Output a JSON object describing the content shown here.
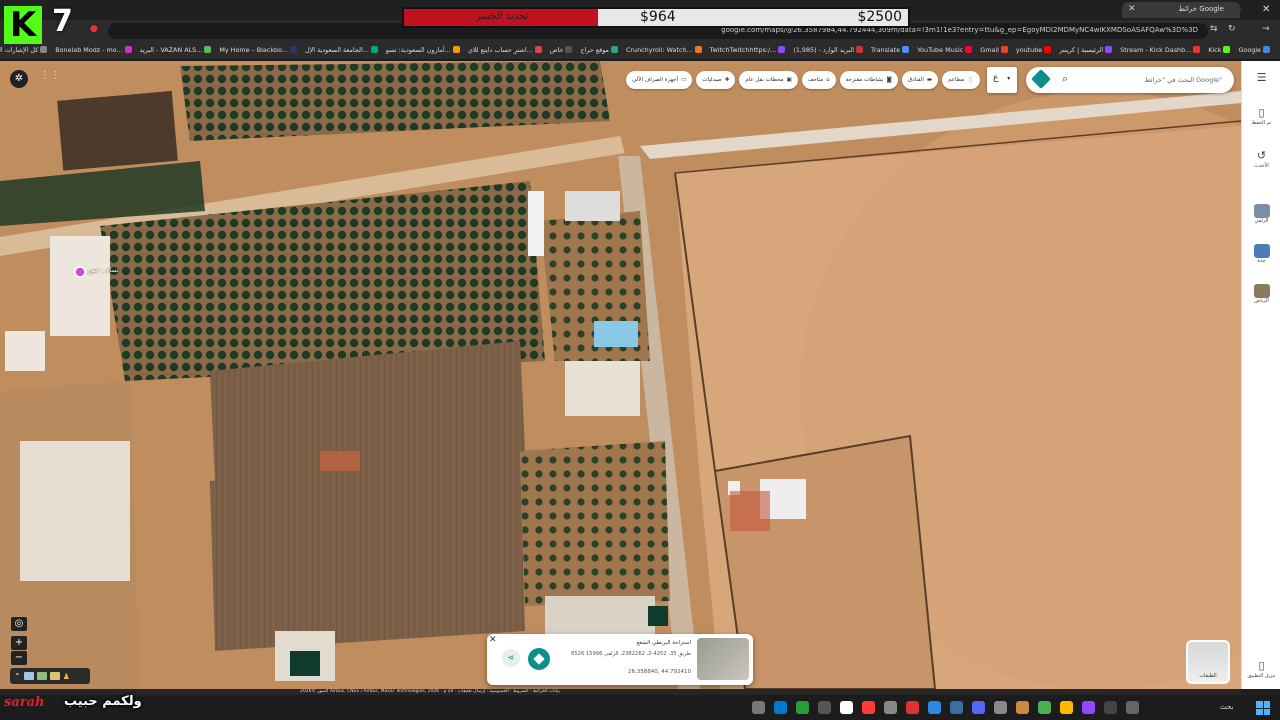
{
  "browser": {
    "tab_title": "خرائط Google",
    "url": "google.com/maps/@26.3587984,44.792444,309m/data=!3m1!1e3?entry=ttu&g_ep=EgoyMDI2MDMyNC4wIKXMDSoASAFQAw%3D%3D",
    "bookmarks": [
      "Google",
      "Kick",
      "Stream - Kick Dashb...",
      "الرئيسية | كرينتر",
      "youtube",
      "Gmail",
      "YouTube Music",
      "Translate",
      "البريد الوارد - (1,985)",
      "TwitchTwitchhttps:/...",
      "Crunchyroll: Watch...",
      "موقع حراج",
      "خاص",
      "اشترِ حساب دايتع للاي...",
      "أمازون السعودية: تسو...",
      "الجامعة السعودية الإل...",
      "My Home – Blackbo...",
      "البريد - VAZAN ALS...",
      "Bonelab Modz - mo...",
      "كل الإشارات المرجعية"
    ]
  },
  "overlay": {
    "logo_letter": "K",
    "viewer_number": "7",
    "goal_label": "تجديد الجسر",
    "goal_current": "$964",
    "goal_target": "$2500",
    "goal_fraction": 0.3856,
    "caption": "ولكمم حبيب",
    "signature": "sarah"
  },
  "maps": {
    "search_placeholder": "البحث في \"خرائط Google\"",
    "lang_button": "ع",
    "chips": [
      {
        "label": "مطاعم",
        "icon": "fork-knife-icon"
      },
      {
        "label": "الفنادق",
        "icon": "bed-icon"
      },
      {
        "label": "نشاطات مقترحة",
        "icon": "camera-icon"
      },
      {
        "label": "متاحف",
        "icon": "museum-icon"
      },
      {
        "label": "محطات نقل عام",
        "icon": "bus-icon"
      },
      {
        "label": "صيدليات",
        "icon": "pharmacy-icon"
      },
      {
        "label": "أجهزة الصراف الآلي",
        "icon": "atm-icon"
      }
    ],
    "rail": [
      {
        "label": "تم الحفظ",
        "icon": "bookmark-icon"
      },
      {
        "label": "الأحدث",
        "icon": "history-icon"
      },
      {
        "label": "الزلفي",
        "icon": "place-thumb"
      },
      {
        "label": "جدة",
        "icon": "place-thumb"
      },
      {
        "label": "الرياض",
        "icon": "place-thumb"
      },
      {
        "label": "تنزيل التطبيق",
        "icon": "phone-icon"
      }
    ],
    "place_label": "نساء... حص",
    "card": {
      "title": "استراحة البرنطي الشغع",
      "address": "8526 طريق 35، 4252-2، 2382262، الزلفي 15996",
      "coords": "26.358840, 44.792410"
    },
    "layers_label": "الطبقات",
    "attribution": "الصور ©2026 Airbus, CNES / Airbus, Maxar Technologies, 2026 · بيانات الخرائط · الشروط · الخصوصية · إرسال تعليقات · 20 م"
  },
  "taskbar": {
    "search_label": "بحث"
  },
  "colors": {
    "kick_green": "#53fc18",
    "goal_red": "#c1121f",
    "maps_teal": "#0b8e8c"
  }
}
